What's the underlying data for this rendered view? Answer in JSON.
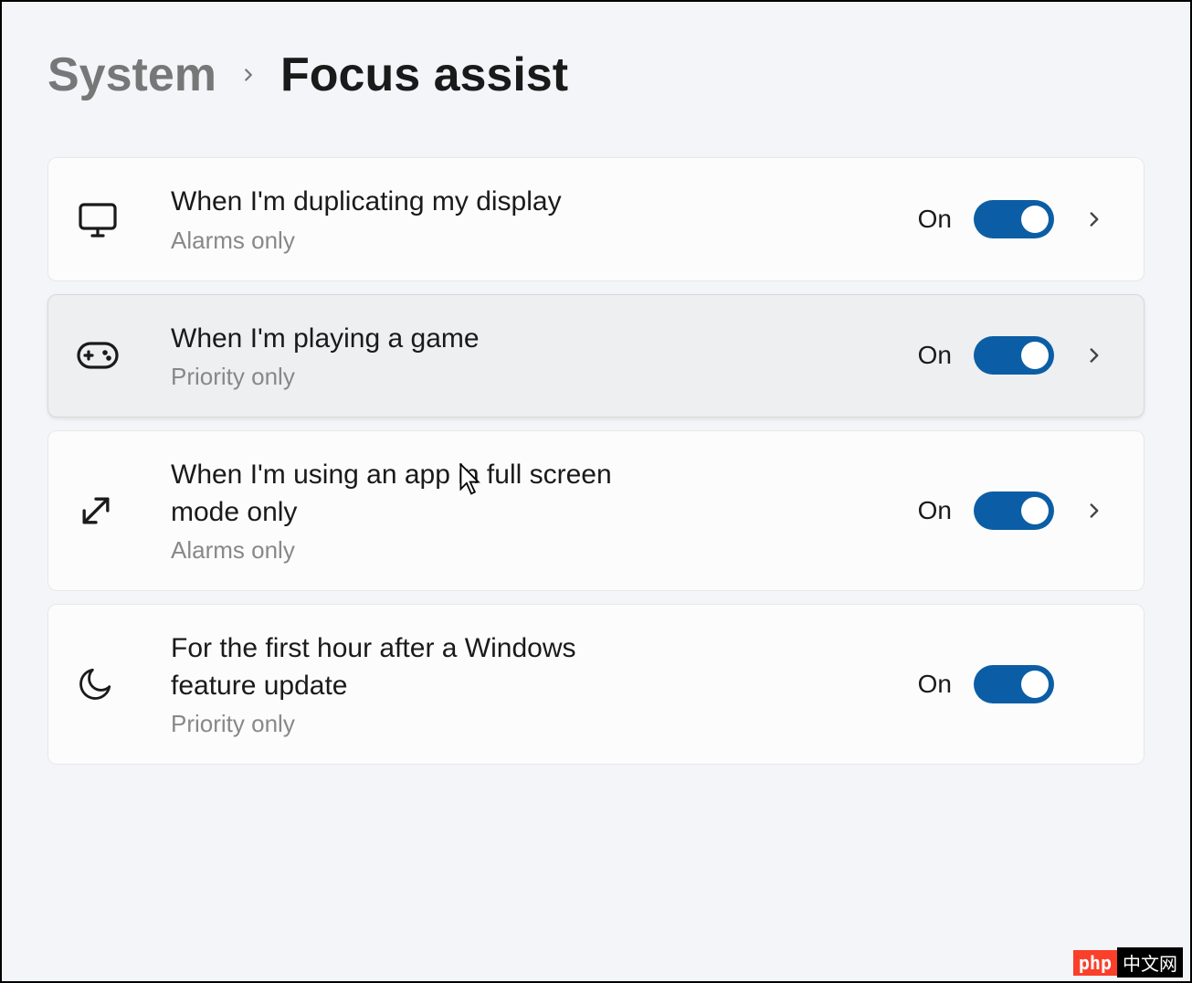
{
  "breadcrumb": {
    "parent": "System",
    "current": "Focus assist"
  },
  "rows": [
    {
      "icon": "monitor-icon",
      "title": "When I'm duplicating my display",
      "subtitle": "Alarms only",
      "state_label": "On",
      "has_chevron": true,
      "hover": false
    },
    {
      "icon": "gamepad-icon",
      "title": "When I'm playing a game",
      "subtitle": "Priority only",
      "state_label": "On",
      "has_chevron": true,
      "hover": true
    },
    {
      "icon": "fullscreen-icon",
      "title": "When I'm using an app in full screen mode only",
      "subtitle": "Alarms only",
      "state_label": "On",
      "has_chevron": true,
      "hover": false
    },
    {
      "icon": "moon-icon",
      "title": "For the first hour after a Windows feature update",
      "subtitle": "Priority only",
      "state_label": "On",
      "has_chevron": false,
      "hover": false
    }
  ],
  "colors": {
    "accent": "#0b5ea5",
    "bg": "#f3f5f9"
  },
  "watermark": {
    "left": "php",
    "right": "中文网"
  }
}
